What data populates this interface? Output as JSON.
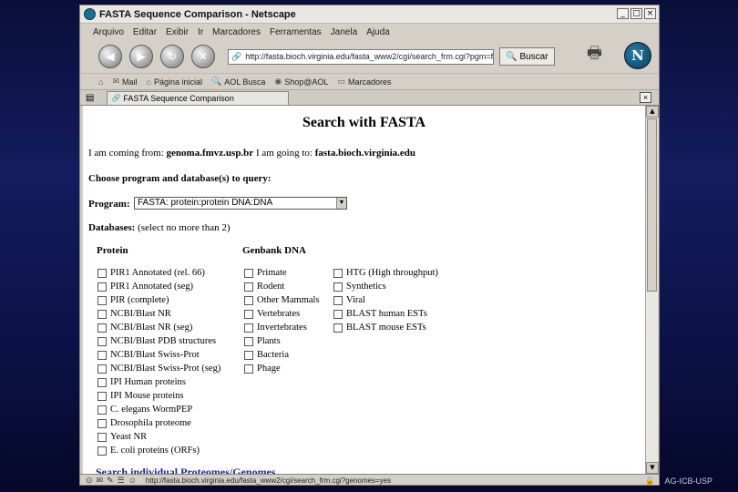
{
  "window": {
    "title": "FASTA Sequence Comparison - Netscape"
  },
  "menu": [
    "Arquivo",
    "Editar",
    "Exibir",
    "Ir",
    "Marcadores",
    "Ferramentas",
    "Janela",
    "Ajuda"
  ],
  "nav": {
    "url": "http://fasta.bioch.virginia.edu/fasta_www2/cgi/search_frm.cgi?pgm=fa",
    "search_label": "Buscar"
  },
  "bookmarks": [
    "Mail",
    "Página inicial",
    "AOL Busca",
    "Shop@AOL",
    "Marcadores"
  ],
  "tab": {
    "label": "FASTA Sequence Comparison"
  },
  "page": {
    "title": "Search with FASTA",
    "coming_from_label": "I am coming from:",
    "coming_from": "genoma.fmvz.usp.br",
    "going_to_label": "I am going to:",
    "going_to": "fasta.bioch.virginia.edu",
    "choose_label": "Choose program and database(s) to query:",
    "program_label": "Program:",
    "program_value": "FASTA: protein:protein DNA:DNA",
    "databases_label": "Databases:",
    "databases_note": "(select no more than 2)",
    "protein_heading": "Protein",
    "genbank_heading": "Genbank DNA",
    "protein_dbs": [
      "PIR1 Annotated (rel. 66)",
      "PIR1 Annotated (seg)",
      "PIR (complete)",
      "NCBI/Blast NR",
      "NCBI/Blast NR (seg)",
      "NCBI/Blast PDB structures",
      "NCBI/Blast Swiss-Prot",
      "NCBI/Blast Swiss-Prot (seg)",
      "IPI Human proteins",
      "IPI Mouse proteins",
      "C. elegans WormPEP",
      "Drosophila proteome",
      "Yeast NR",
      "E. coli proteins (ORFs)"
    ],
    "genbank_dbs": [
      "Primate",
      "Rodent",
      "Other Mammals",
      "Vertebrates",
      "Invertebrates",
      "Plants",
      "Bacteria",
      "Phage"
    ],
    "other_dbs": [
      "HTG (High throughput)",
      "Synthetics",
      "Viral",
      "BLAST human ESTs",
      "BLAST mouse ESTs"
    ],
    "bottom_heading": "Search individual Proteomes/Genomes"
  },
  "status": {
    "url": "http://fasta.bioch.virginia.edu/fasta_www2/cgi/search_frm.cgi?genomes=yes"
  },
  "footer": "AG-ICB-USP"
}
